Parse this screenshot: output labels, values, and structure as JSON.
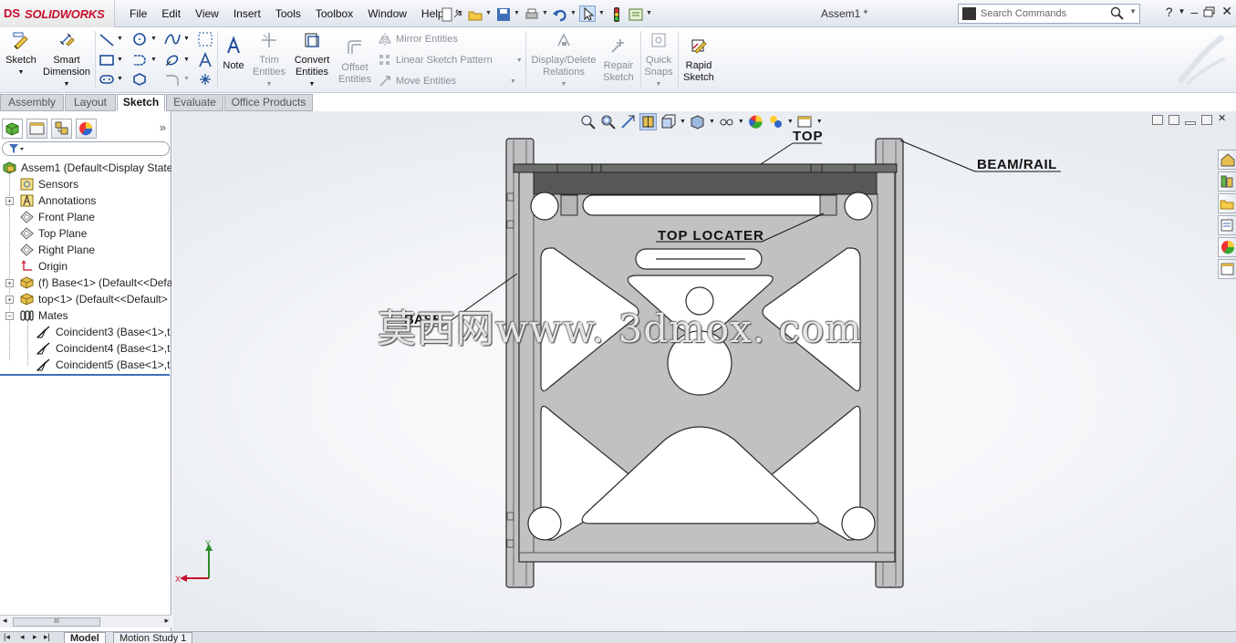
{
  "app": {
    "brand_prefix": "DS",
    "brand_name": "SOLIDWORKS",
    "document_title": "Assem1 *"
  },
  "menu": [
    "File",
    "Edit",
    "View",
    "Insert",
    "Tools",
    "Toolbox",
    "Window",
    "Help"
  ],
  "search": {
    "placeholder": "Search Commands"
  },
  "ribbon": {
    "sketch": "Sketch",
    "smart_dimension_1": "Smart",
    "smart_dimension_2": "Dimension",
    "note": "Note",
    "trim_1": "Trim",
    "trim_2": "Entities",
    "convert_1": "Convert",
    "convert_2": "Entities",
    "offset_1": "Offset",
    "offset_2": "Entities",
    "mirror": "Mirror Entities",
    "linear_pattern": "Linear Sketch Pattern",
    "move": "Move Entities",
    "display_delete_1": "Display/Delete",
    "display_delete_2": "Relations",
    "repair_1": "Repair",
    "repair_2": "Sketch",
    "quick_snaps_1": "Quick",
    "quick_snaps_2": "Snaps",
    "rapid_1": "Rapid",
    "rapid_2": "Sketch"
  },
  "tabs": [
    "Assembly",
    "Layout",
    "Sketch",
    "Evaluate",
    "Office Products"
  ],
  "active_tab": "Sketch",
  "tree": {
    "root": "Assem1  (Default<Display State",
    "items": [
      "Sensors",
      "Annotations",
      "Front Plane",
      "Top Plane",
      "Right Plane",
      "Origin",
      "(f) Base<1> (Default<<Defa",
      "top<1> (Default<<Default>",
      "Mates",
      "Coincident3 (Base<1>,t",
      "Coincident4 (Base<1>,t",
      "Coincident5 (Base<1>,t"
    ],
    "scroll_label": "III"
  },
  "bottom_tabs": [
    "Model",
    "Motion Study 1"
  ],
  "drawing": {
    "label_top": "TOP",
    "label_beam": "BEAM/RAIL",
    "label_locater": "TOP LOCATER",
    "label_base": "BASE",
    "triad_x": "X",
    "triad_y": "Y"
  },
  "watermark": "莫西网www. 3dmox. com",
  "colors": {
    "brand_red": "#c8102e",
    "part_gray": "#c0c1c3",
    "rail_dark": "#555855",
    "tab_active": "#ffffff"
  },
  "icons": {
    "feature_manager": "feature-manager-icon",
    "property_manager": "property-manager-icon",
    "configuration_manager": "configuration-manager-icon",
    "display_manager": "display-manager-icon"
  }
}
